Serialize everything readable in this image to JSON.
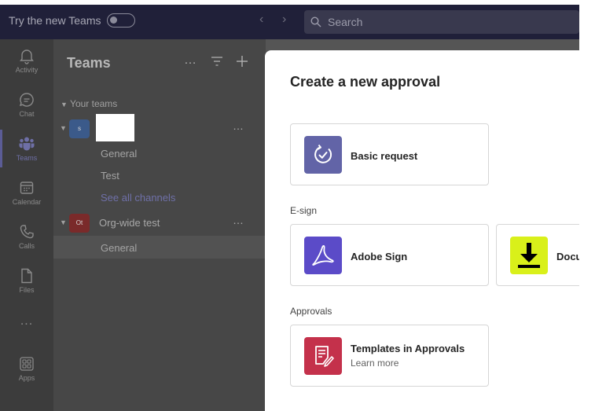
{
  "topbar": {
    "try_new_teams": "Try the new Teams",
    "search_placeholder": "Search"
  },
  "rail": {
    "items": [
      {
        "label": "Activity",
        "icon": "bell-icon"
      },
      {
        "label": "Chat",
        "icon": "chat-icon"
      },
      {
        "label": "Teams",
        "icon": "teams-icon",
        "active": true
      },
      {
        "label": "Calendar",
        "icon": "calendar-icon"
      },
      {
        "label": "Calls",
        "icon": "phone-icon"
      },
      {
        "label": "Files",
        "icon": "file-icon"
      },
      {
        "label": "Apps",
        "icon": "apps-icon"
      }
    ],
    "more": "..."
  },
  "teams_panel": {
    "title": "Teams",
    "section_label": "Your teams",
    "teams": [
      {
        "avatar_text": "s",
        "avatar_color": "#3b5a8a",
        "channels": [
          "General",
          "Test"
        ],
        "see_all": "See all channels"
      },
      {
        "avatar_text": "Ot",
        "avatar_color": "#7a2a2a",
        "name": "Org-wide test",
        "channels": [
          "General"
        ]
      }
    ]
  },
  "dialog": {
    "title": "Create a new approval",
    "basic": {
      "label": "Basic request",
      "icon": "approval-check-icon",
      "color": "#6264a7"
    },
    "esign_label": "E-sign",
    "adobe": {
      "label": "Adobe Sign",
      "icon": "adobe-sign-icon",
      "color": "#5b4bc8"
    },
    "docusign": {
      "label": "Docu",
      "icon": "docusign-download-icon",
      "color": "#d9f01a"
    },
    "approvals_label": "Approvals",
    "templates": {
      "label": "Templates in Approvals",
      "sub": "Learn more",
      "icon": "template-icon",
      "color": "#c4314b"
    }
  },
  "colors": {
    "topbar": "#202039",
    "rail": "#3c3c3c",
    "panel": "#474747",
    "accent": "#6264a7"
  }
}
